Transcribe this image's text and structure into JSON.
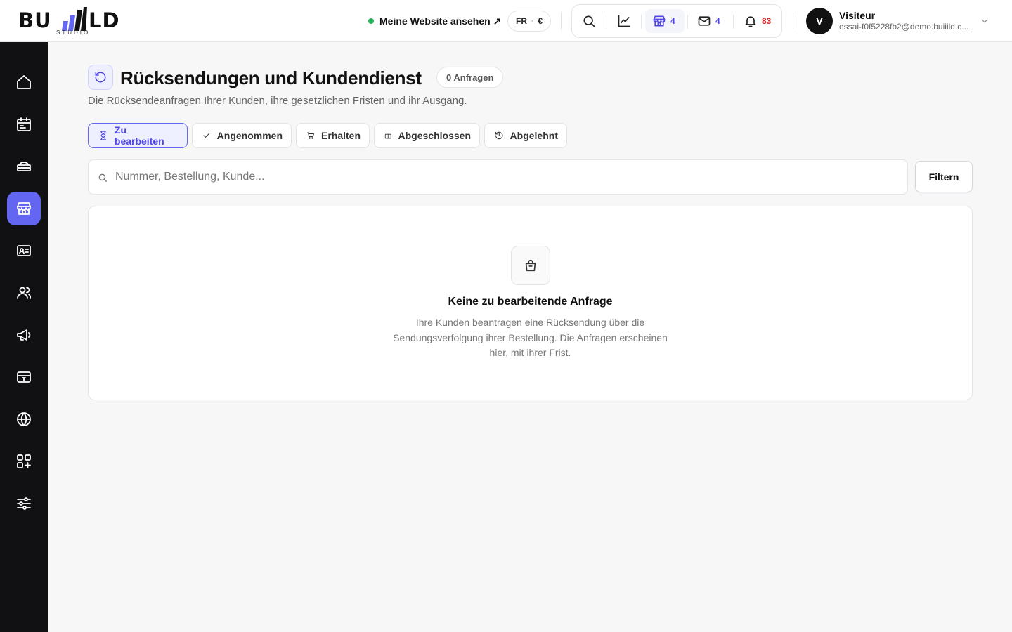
{
  "brand": {
    "logo_left": "BU",
    "logo_right": "LD",
    "logo_sub": "STUDIO",
    "accent": "#6366f1"
  },
  "header": {
    "site_link": "Meine Website ansehen ↗",
    "lang": "FR",
    "currency": "€",
    "store_count": "4",
    "mail_count": "4",
    "notif_count": "83",
    "user": {
      "initial": "V",
      "name": "Visiteur",
      "email": "essai-f0f5228fb2@demo.buiiild.c..."
    }
  },
  "sidebar": {
    "items": [
      "home-icon",
      "calendar-icon",
      "layers-icon",
      "store-icon",
      "contact-card-icon",
      "users-icon",
      "megaphone-icon",
      "credit-card-icon",
      "globe-icon",
      "apps-icon",
      "sliders-icon"
    ],
    "active": "store-icon"
  },
  "page": {
    "title": "Rücksendungen und Kundendienst",
    "count_badge": "0 Anfragen",
    "subtitle": "Die Rücksendeanfragen Ihrer Kunden, ihre gesetzlichen Fristen und ihr Ausgang."
  },
  "tabs": [
    {
      "label": "Zu bearbeiten",
      "icon": "hourglass-icon"
    },
    {
      "label": "Angenommen",
      "icon": "check-icon"
    },
    {
      "label": "Erhalten",
      "icon": "cart-icon"
    },
    {
      "label": "Abgeschlossen",
      "icon": "gift-icon"
    },
    {
      "label": "Abgelehnt",
      "icon": "history-icon"
    }
  ],
  "search": {
    "placeholder": "Nummer, Bestellung, Kunde...",
    "value": ""
  },
  "filter_label": "Filtern",
  "empty": {
    "title": "Keine zu bearbeitende Anfrage",
    "text": "Ihre Kunden beantragen eine Rücksendung über die Sendungsverfolgung ihrer Bestellung. Die Anfragen erscheinen hier, mit ihrer Frist."
  }
}
